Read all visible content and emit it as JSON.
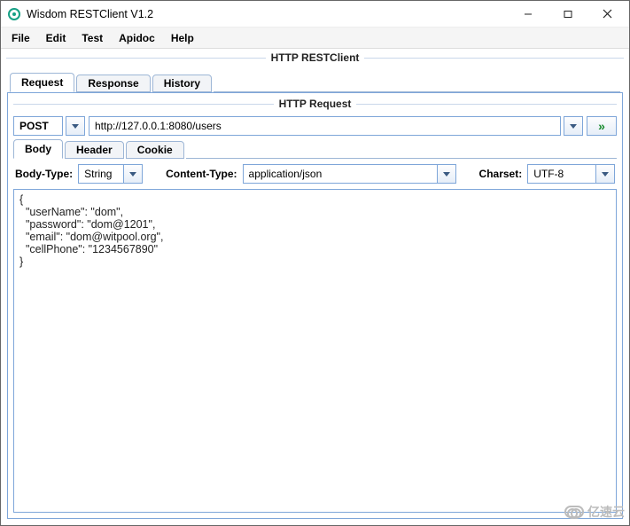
{
  "window": {
    "title": "Wisdom RESTClient V1.2"
  },
  "menus": [
    "File",
    "Edit",
    "Test",
    "Apidoc",
    "Help"
  ],
  "section_titles": {
    "client": "HTTP RESTClient",
    "request": "HTTP Request"
  },
  "main_tabs": [
    "Request",
    "Response",
    "History"
  ],
  "active_main_tab": 0,
  "method": {
    "value": "POST"
  },
  "url": {
    "value": "http://127.0.0.1:8080/users"
  },
  "sub_tabs": [
    "Body",
    "Header",
    "Cookie"
  ],
  "active_sub_tab": 0,
  "body_form": {
    "body_type_label": "Body-Type:",
    "body_type_value": "String",
    "content_type_label": "Content-Type:",
    "content_type_value": "application/json",
    "charset_label": "Charset:",
    "charset_value": "UTF-8"
  },
  "body_text": "{\n  \"userName\": \"dom\",\n  \"password\": \"dom@1201\",\n  \"email\": \"dom@witpool.org\",\n  \"cellPhone\": \"1234567890\"\n}",
  "watermark": "亿速云"
}
